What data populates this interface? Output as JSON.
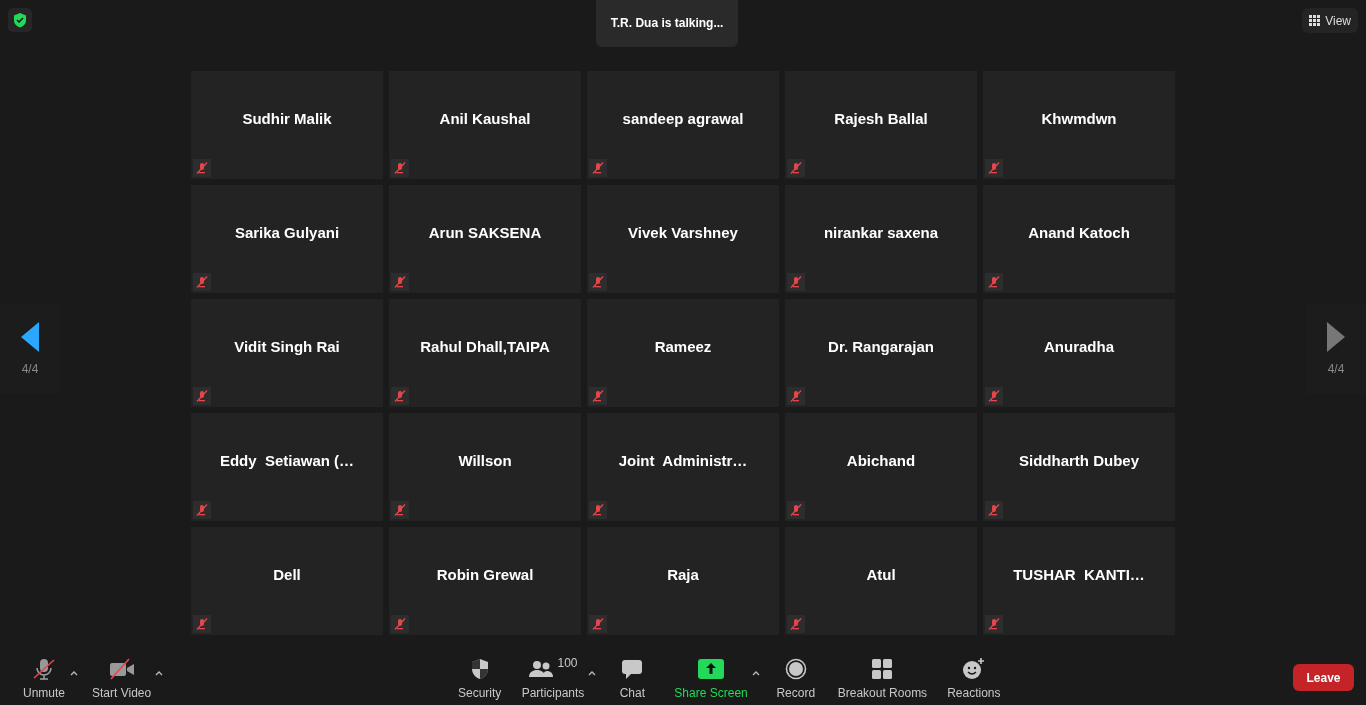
{
  "talking_banner": "T.R. Dua is talking...",
  "view_button": "View",
  "pager_left": {
    "label": "4/4",
    "enabled": true
  },
  "pager_right": {
    "label": "4/4",
    "enabled": false
  },
  "tiles": [
    {
      "name": "Sudhir Malik",
      "muted": true
    },
    {
      "name": "Anil Kaushal",
      "muted": true
    },
    {
      "name": "sandeep agrawal",
      "muted": true
    },
    {
      "name": "Rajesh Ballal",
      "muted": true
    },
    {
      "name": "Khwmdwn",
      "muted": true
    },
    {
      "name": "Sarika Gulyani",
      "muted": true
    },
    {
      "name": "Arun SAKSENA",
      "muted": true
    },
    {
      "name": "Vivek Varshney",
      "muted": true
    },
    {
      "name": "nirankar saxena",
      "muted": true
    },
    {
      "name": "Anand Katoch",
      "muted": true
    },
    {
      "name": "Vidit Singh Rai",
      "muted": true
    },
    {
      "name": "Rahul Dhall,TAIPA",
      "muted": true
    },
    {
      "name": "Rameez",
      "muted": true
    },
    {
      "name": "Dr. Rangarajan",
      "muted": true
    },
    {
      "name": "Anuradha",
      "muted": true
    },
    {
      "name": "Eddy  Setiawan (…",
      "muted": true
    },
    {
      "name": "Willson",
      "muted": true
    },
    {
      "name": "Joint  Administr…",
      "muted": true
    },
    {
      "name": "Abichand",
      "muted": true
    },
    {
      "name": "Siddharth Dubey",
      "muted": true
    },
    {
      "name": "Dell",
      "muted": true
    },
    {
      "name": "Robin Grewal",
      "muted": true
    },
    {
      "name": "Raja",
      "muted": true
    },
    {
      "name": "Atul",
      "muted": true
    },
    {
      "name": "TUSHAR  KANTI…",
      "muted": true
    }
  ],
  "toolbar_left": [
    {
      "kind": "mic",
      "label": "Unmute",
      "off": true,
      "caret": true
    },
    {
      "kind": "video",
      "label": "Start Video",
      "off": true,
      "caret": true
    }
  ],
  "toolbar_center": [
    {
      "kind": "security",
      "label": "Security",
      "caret": false,
      "active": false
    },
    {
      "kind": "participants",
      "label": "Participants",
      "count": "100",
      "caret": true,
      "active": false
    },
    {
      "kind": "chat",
      "label": "Chat",
      "caret": false,
      "active": false
    },
    {
      "kind": "share",
      "label": "Share Screen",
      "caret": true,
      "active": true
    },
    {
      "kind": "record",
      "label": "Record",
      "caret": false,
      "active": false
    },
    {
      "kind": "breakout",
      "label": "Breakout Rooms",
      "caret": false,
      "active": false
    },
    {
      "kind": "reactions",
      "label": "Reactions",
      "caret": false,
      "active": false
    }
  ],
  "leave_button": "Leave"
}
